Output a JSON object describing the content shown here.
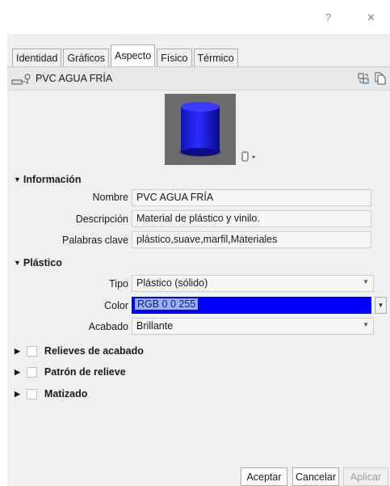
{
  "window": {
    "help_label": "?",
    "close_label": "✕"
  },
  "tabs": [
    {
      "label": "Identidad"
    },
    {
      "label": "Gráficos"
    },
    {
      "label": "Aspecto"
    },
    {
      "label": "Físico"
    },
    {
      "label": "Térmico"
    }
  ],
  "material": {
    "name": "PVC AGUA FRÍA"
  },
  "sections": {
    "info": {
      "header": "Información",
      "nombre_label": "Nombre",
      "nombre_value": "PVC AGUA FRÍA",
      "descripcion_label": "Descripción",
      "descripcion_value": "Material de plástico y vinilo.",
      "palabras_label": "Palabras clave",
      "palabras_value": "plástico,suave,marfil,Materiales"
    },
    "plastico": {
      "header": "Plástico",
      "tipo_label": "Tipo",
      "tipo_value": "Plástico (sólido)",
      "color_label": "Color",
      "color_value": "RGB 0 0 255",
      "color_swatch": "#0000ff",
      "acabado_label": "Acabado",
      "acabado_value": "Brillante"
    },
    "collapsed": [
      {
        "label": "Relieves de acabado"
      },
      {
        "label": "Patrón de relieve"
      },
      {
        "label": "Matizado"
      }
    ]
  },
  "buttons": {
    "accept": "Aceptar",
    "cancel": "Cancelar",
    "apply": "Aplicar"
  }
}
